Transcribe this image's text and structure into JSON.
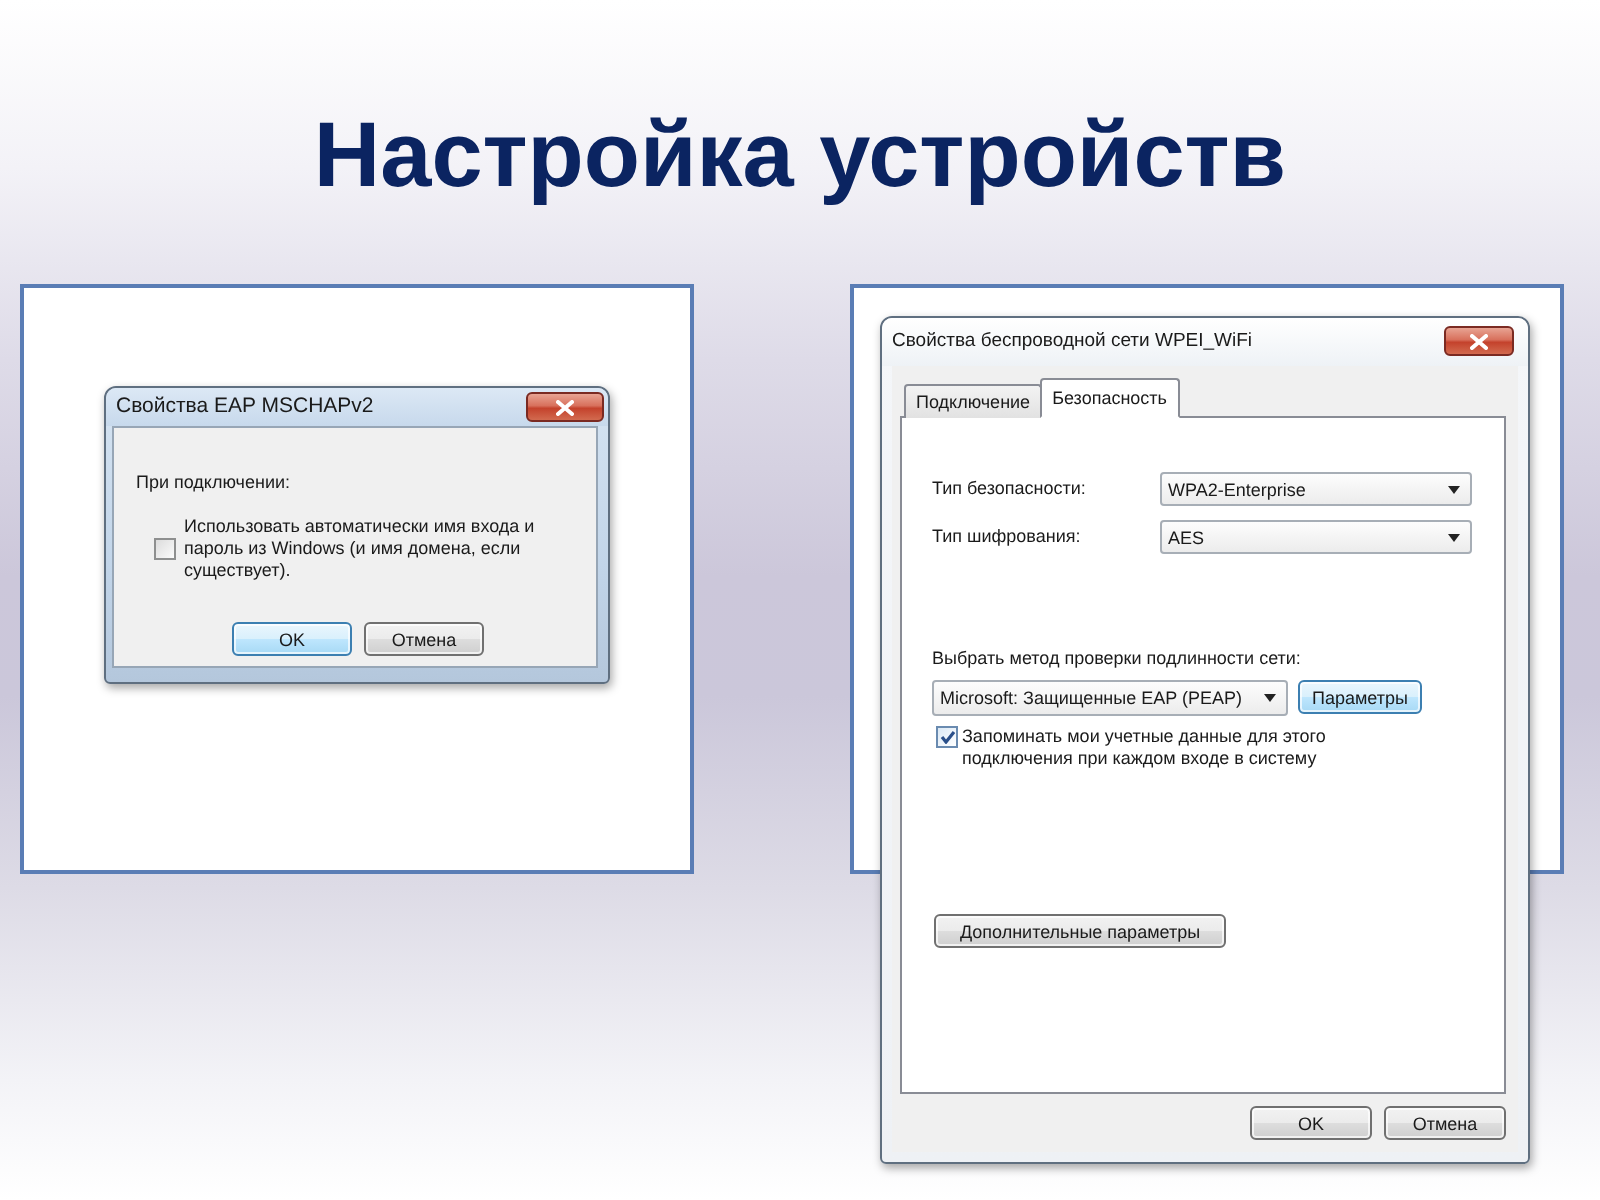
{
  "title": "Настройка устройств",
  "left_dialog": {
    "title": "Свойства EAP MSCHAPv2",
    "group_label": "При подключении:",
    "checkbox": {
      "label": "Использовать автоматически имя входа и пароль из Windows (и имя домена, если существует).",
      "checked": false
    },
    "buttons": [
      {
        "label": "OK",
        "highlighted": true
      },
      {
        "label": "Отмена",
        "highlighted": false
      }
    ]
  },
  "right_dialog": {
    "title": "Свойства беспроводной сети WPEI_WiFi",
    "tabs": [
      {
        "label": "Подключение",
        "selected": false
      },
      {
        "label": "Безопасность",
        "selected": true
      }
    ],
    "fields": [
      {
        "label": "Тип безопасности:",
        "value": "WPA2-Enterprise"
      },
      {
        "label": "Тип шифрования:",
        "value": "AES"
      }
    ],
    "auth_method": {
      "label": "Выбрать метод проверки подлинности сети:",
      "value": "Microsoft: Защищенные EAP (PEAP)",
      "button": {
        "label": "Параметры",
        "highlighted": true
      }
    },
    "remember_checkbox": {
      "label": "Запоминать мои учетные данные для этого подключения при каждом входе в систему",
      "checked": true
    },
    "advanced_button": {
      "label": "Дополнительные параметры",
      "highlighted": false
    },
    "buttons": [
      {
        "label": "OK",
        "highlighted": false
      },
      {
        "label": "Отмена",
        "highlighted": false
      }
    ]
  }
}
